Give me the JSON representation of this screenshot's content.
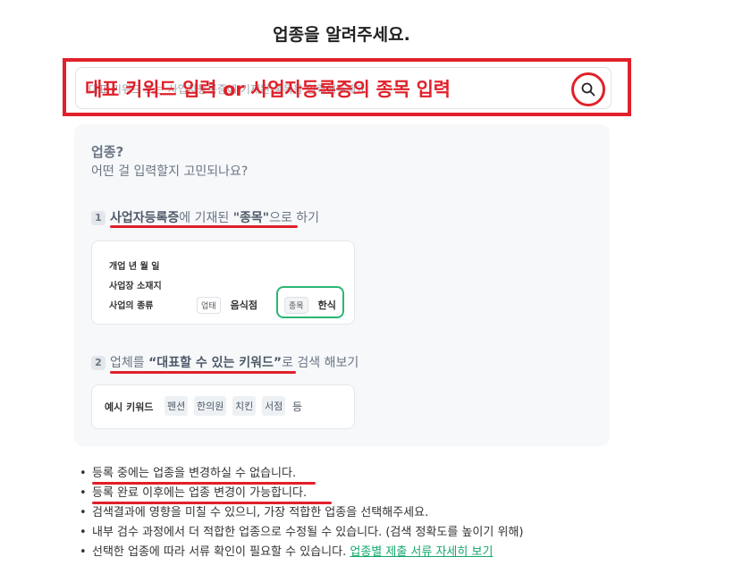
{
  "page": {
    "title": "업종을 알려주세요."
  },
  "search": {
    "placeholder": "대표 키워드 또는 사업자등록증에 기재된 종목을 입력해주세요.",
    "hint_overlay": "대표 키워드 입력 or 사업자등록증의 종목 입력",
    "button_icon": "search-icon"
  },
  "guide": {
    "title": "업종?",
    "subtitle": "어떤 걸 입력할지 고민되나요?",
    "step1": {
      "num": "1",
      "pre": "사업자등록증",
      "mid": "에 기재된 ",
      "bold": "\"종목\"",
      "post": "으로 하기"
    },
    "sample_cert": {
      "row1_label": "개업 년 월 일",
      "row2_label": "사업장 소재지",
      "row3_label": "사업의 종류",
      "type_tag": "업태",
      "type_value": "음식점",
      "item_tag": "종목",
      "item_value": "한식"
    },
    "step2": {
      "num": "2",
      "pre": "업체",
      "mid": "를 ",
      "bold": "“대표할 수 있는 키워드”",
      "post": "로 검색 해보기"
    },
    "keywords": {
      "label": "예시 키워드",
      "items": [
        "펜션",
        "한의원",
        "치킨",
        "서점"
      ],
      "etc": "등"
    }
  },
  "notes": [
    "등록 중에는 업종을 변경하실 수 없습니다.",
    "등록 완료 이후에는 업종 변경이 가능합니다.",
    "검색결과에 영향을 미칠 수 있으니, 가장 적합한 업종을 선택해주세요.",
    "내부 검수 과정에서 더 적합한 업종으로 수정될 수 있습니다. (검색 정확도를 높이기 위해)",
    "선택한 업종에 따라 서류 확인이 필요할 수 있습니다."
  ],
  "notes_link": "업종별 제출 서류 자세히 보기",
  "colors": {
    "annotation": "#e0202a",
    "accent": "#15a86a"
  }
}
